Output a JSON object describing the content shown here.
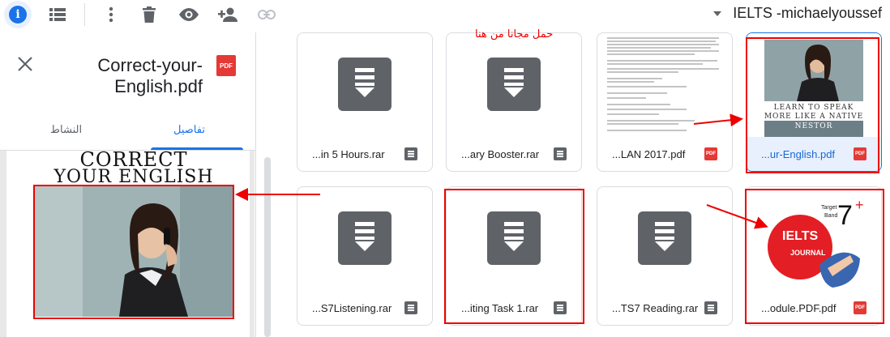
{
  "toolbar": {
    "folder_title": "IELTS -michaelyoussef",
    "icons": [
      "info-icon",
      "details-icon",
      "more-icon",
      "trash-icon",
      "preview-icon",
      "share-icon",
      "link-icon"
    ]
  },
  "panel": {
    "file_title": "Correct-your-English.pdf",
    "tab_details": "تفاصيل",
    "tab_activity": "النشاط",
    "cover_line1": "CORRECT",
    "cover_line2": "YOUR ENGLISH"
  },
  "files": [
    {
      "name": "...in 5 Hours.rar",
      "type": "archive"
    },
    {
      "name": "...ary Booster.rar",
      "type": "archive",
      "note": "حمل مجانا من هنا"
    },
    {
      "name": "...LAN 2017.pdf",
      "type": "pdf"
    },
    {
      "name": "...ur-English.pdf",
      "type": "pdf",
      "selected": true,
      "cover_line1": "LEARN TO SPEAK",
      "cover_line2": "MORE LIKE A NATIVE",
      "cover_line3": "NESTOR"
    },
    {
      "name": "...S7Listening.rar",
      "type": "archive"
    },
    {
      "name": "...iting Task 1.rar",
      "type": "archive"
    },
    {
      "name": "...TS7 Reading.rar",
      "type": "archive"
    },
    {
      "name": "...odule.PDF.pdf",
      "type": "pdf",
      "badge_main": "IELTS",
      "badge_sub": "JOURNAL",
      "target_label": "Target",
      "band_label": "Band",
      "band_value": "7",
      "band_plus": "+"
    }
  ],
  "colors": {
    "accent": "#1a73e8",
    "annotation": "#ee0000",
    "pdf": "#e53935",
    "archive": "#5f6368"
  }
}
